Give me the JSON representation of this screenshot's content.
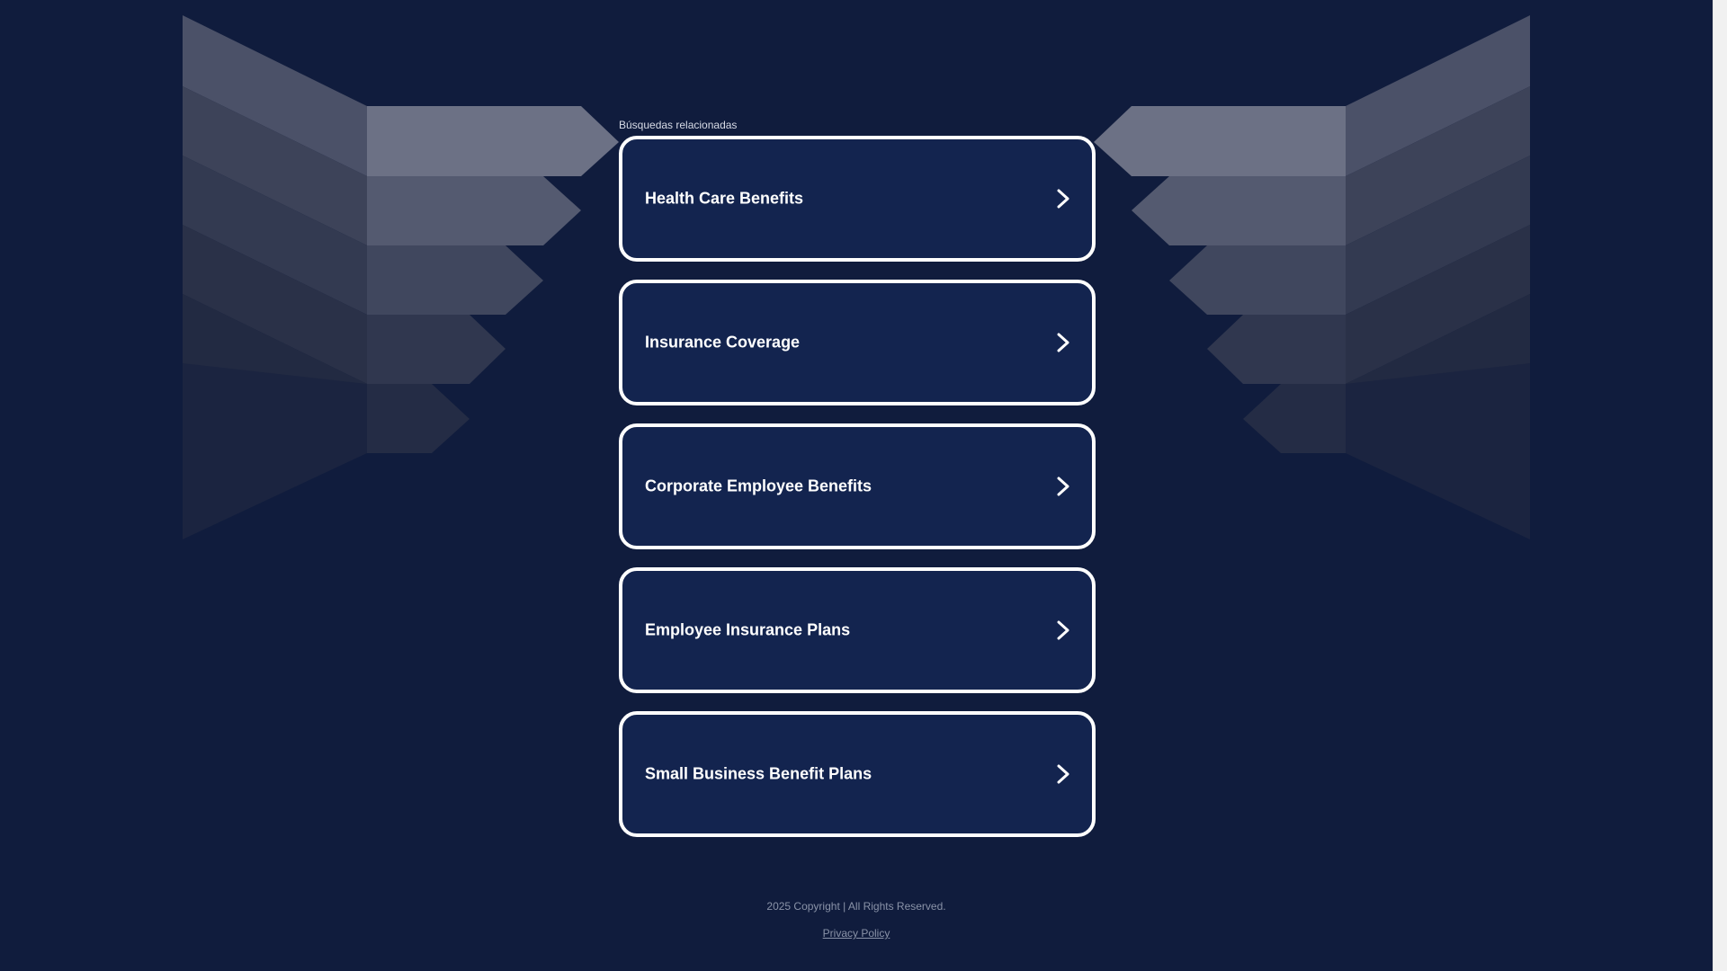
{
  "related_searches": {
    "heading": "Búsquedas relacionadas",
    "links": [
      {
        "label": "Health Care Benefits"
      },
      {
        "label": "Insurance Coverage"
      },
      {
        "label": "Corporate Employee Benefits"
      },
      {
        "label": "Employee Insurance Plans"
      },
      {
        "label": "Small Business Benefit Plans"
      }
    ],
    "link_icon": "chevron-right-icon"
  },
  "footer": {
    "copyright": "2025 Copyright | All Rights Reserved.",
    "privacy_label": "Privacy Policy"
  },
  "colors": {
    "background": "#101c3d",
    "card_fill": "#13244f",
    "card_border": "#ffffff",
    "footer_text": "#8a93a8"
  }
}
